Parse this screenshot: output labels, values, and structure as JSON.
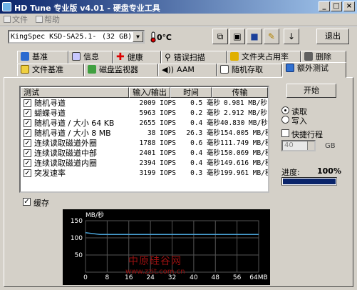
{
  "window": {
    "title": "HD Tune 专业版 v4.01 - 硬盘专业工具",
    "minimize": "_",
    "maximize": "□",
    "close": "×"
  },
  "menu": [
    "文件",
    "帮助"
  ],
  "drive": {
    "name": "KingSpec KSD-SA25.1-",
    "size": "(32 GB)",
    "temperature": "0℃"
  },
  "toolbar": {
    "exit_label": "退出"
  },
  "tabs_row1": [
    "基准",
    "信息",
    "健康",
    "错误扫描",
    "文件夹占用率",
    "删除"
  ],
  "tabs_row2": [
    "文件基准",
    "磁盘监视器",
    "AAM",
    "随机存取",
    "额外测试"
  ],
  "table": {
    "headers": [
      "测试",
      "输入/输出",
      "时间",
      "传输"
    ],
    "rows": [
      {
        "name": "随机寻道",
        "ops": "2009 IOPS",
        "time": "0.5 毫秒",
        "transfer": "0.981 MB/秒",
        "checked": true
      },
      {
        "name": "蝴蝶寻道",
        "ops": "5963 IOPS",
        "time": "0.2 毫秒",
        "transfer": "2.912 MB/秒",
        "checked": true
      },
      {
        "name": "随机寻道 / 大小 64 KB",
        "ops": "2655 IOPS",
        "time": "0.4 毫秒",
        "transfer": "40.830 MB/秒",
        "checked": true
      },
      {
        "name": "随机寻道 / 大小 8 MB",
        "ops": "38 IOPS",
        "time": "26.3 毫秒",
        "transfer": "154.005 MB/秒",
        "checked": true
      },
      {
        "name": "连续读取磁道外圈",
        "ops": "1788 IOPS",
        "time": "0.6 毫秒",
        "transfer": "111.749 MB/秒",
        "checked": true
      },
      {
        "name": "连续读取磁道中部",
        "ops": "2401 IOPS",
        "time": "0.4 毫秒",
        "transfer": "150.069 MB/秒",
        "checked": true
      },
      {
        "name": "连续读取磁道内圈",
        "ops": "2394 IOPS",
        "time": "0.4 毫秒",
        "transfer": "149.616 MB/秒",
        "checked": true
      },
      {
        "name": "突发速率",
        "ops": "3199 IOPS",
        "time": "0.3 毫秒",
        "transfer": "199.961 MB/秒",
        "checked": true
      }
    ]
  },
  "controls": {
    "start_label": "开始",
    "read_label": "读取",
    "write_label": "写入",
    "read_selected": true,
    "quick_label": "快捷行程",
    "quick_checked": false,
    "quick_value": "40",
    "quick_unit": "GB",
    "progress_label": "进度:",
    "progress_value": "100%",
    "progress": 1.0,
    "cache_label": "缓存",
    "cache_checked": true,
    "check_mark": "✓"
  },
  "chart_data": {
    "type": "line",
    "ylabel": "MB/秒",
    "xlabel_unit": "MB",
    "y_ticks": [
      50,
      100,
      150
    ],
    "x_ticks": [
      0,
      8,
      16,
      24,
      32,
      40,
      48,
      56,
      64
    ],
    "ylim": [
      0,
      150
    ],
    "xlim": [
      0,
      64
    ],
    "series": [
      {
        "values": [
          115,
          110,
          110,
          110,
          110,
          110,
          110,
          110,
          110,
          110,
          110,
          110,
          110
        ]
      }
    ],
    "colors": {
      "background": "#000000",
      "line": "#4aa3d8",
      "grid": "#555555",
      "tick_text": "#ffffff"
    }
  },
  "watermark": {
    "line1": "中原硅谷网",
    "line2": "www.zzit.com.cn"
  }
}
